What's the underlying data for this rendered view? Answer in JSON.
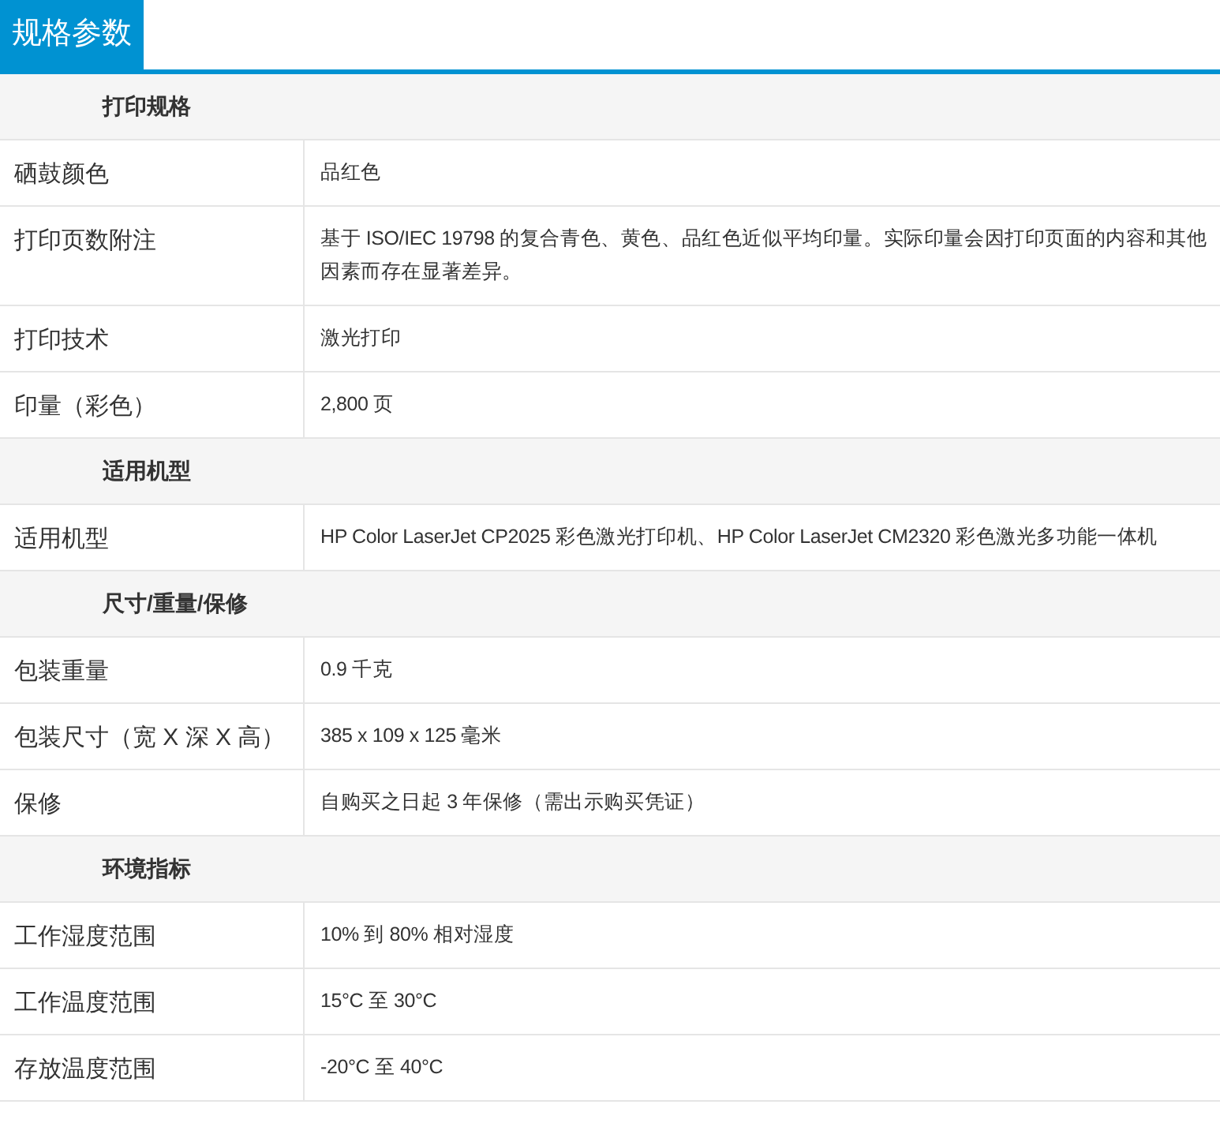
{
  "tab": {
    "label": "规格参数",
    "selected": true
  },
  "sections": [
    {
      "title": "打印规格",
      "rows": [
        {
          "label": "硒鼓颜色",
          "value": "品红色"
        },
        {
          "label": "打印页数附注",
          "value": "基于 ISO/IEC 19798 的复合青色、黄色、品红色近似平均印量。实际印量会因打印页面的内容和其他因素而存在显著差异。"
        },
        {
          "label": "打印技术",
          "value": "激光打印"
        },
        {
          "label": "印量（彩色）",
          "value": "2,800 页"
        }
      ]
    },
    {
      "title": "适用机型",
      "rows": [
        {
          "label": "适用机型",
          "value": "HP Color LaserJet CP2025 彩色激光打印机、HP Color LaserJet CM2320 彩色激光多功能一体机"
        }
      ]
    },
    {
      "title": "尺寸/重量/保修",
      "rows": [
        {
          "label": "包装重量",
          "value": "0.9 千克"
        },
        {
          "label": "包装尺寸（宽 X 深 X 高）",
          "value": "385 x 109 x 125 毫米"
        },
        {
          "label": "保修",
          "value": "自购买之日起 3 年保修（需出示购买凭证）"
        }
      ]
    },
    {
      "title": "环境指标",
      "rows": [
        {
          "label": "工作湿度范围",
          "value": "10% 到 80% 相对湿度"
        },
        {
          "label": "工作温度范围",
          "value": "15°C 至 30°C"
        },
        {
          "label": "存放温度范围",
          "value": "-20°C 至 40°C"
        }
      ]
    }
  ]
}
